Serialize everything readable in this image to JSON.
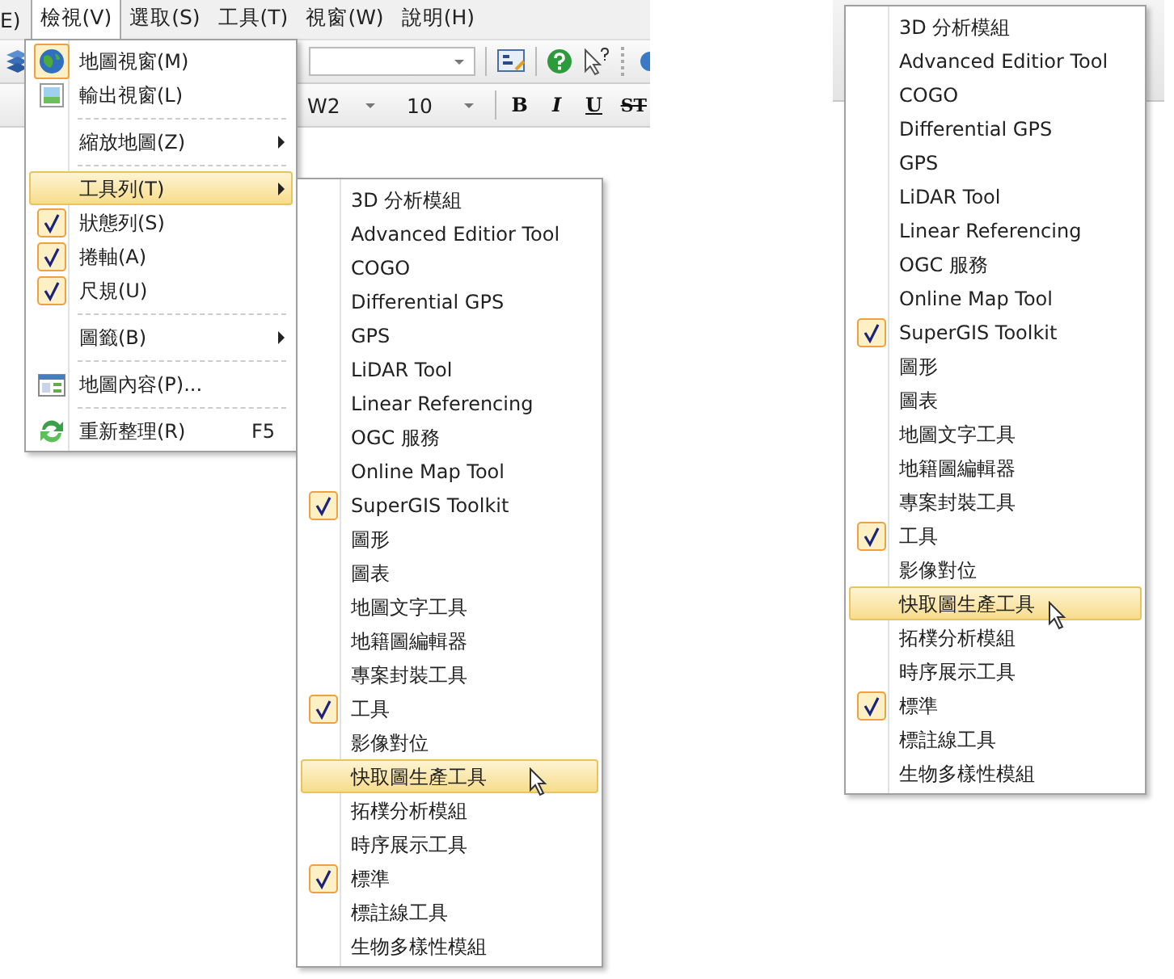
{
  "menu_bar": [
    {
      "label": "E)",
      "selected": false
    },
    {
      "label": "檢視(V)",
      "selected": true
    },
    {
      "label": "選取(S)",
      "selected": false
    },
    {
      "label": "工具(T)",
      "selected": false
    },
    {
      "label": "視窗(W)",
      "selected": false
    },
    {
      "label": "說明(H)",
      "selected": false
    }
  ],
  "toolbar": {
    "font": "W2",
    "size": "10",
    "format_buttons": [
      "B",
      "I",
      "U",
      "ST"
    ]
  },
  "view_menu": [
    {
      "kind": "icon",
      "label": "地圖視窗(M)",
      "checked": true
    },
    {
      "kind": "icon",
      "label": "輸出視窗(L)",
      "checked": false
    },
    {
      "kind": "separator"
    },
    {
      "kind": "submenu",
      "label": "縮放地圖(Z)",
      "selected": false
    },
    {
      "kind": "separator"
    },
    {
      "kind": "submenu",
      "label": "工具列(T)",
      "selected": true
    },
    {
      "kind": "check",
      "label": "狀態列(S)",
      "checked": true
    },
    {
      "kind": "check",
      "label": "捲軸(A)",
      "checked": true
    },
    {
      "kind": "check",
      "label": "尺規(U)",
      "checked": true
    },
    {
      "kind": "separator"
    },
    {
      "kind": "submenu",
      "label": "圖籤(B)",
      "selected": false
    },
    {
      "kind": "separator"
    },
    {
      "kind": "icon",
      "label": "地圖內容(P)...",
      "checked": false
    },
    {
      "kind": "separator"
    },
    {
      "kind": "icon",
      "label": "重新整理(R)",
      "checked": false,
      "shortcut": "F5"
    }
  ],
  "toolbar_submenu": [
    {
      "label": "3D 分析模組",
      "checked": false,
      "selected": false
    },
    {
      "label": "Advanced Editior Tool",
      "checked": false,
      "selected": false
    },
    {
      "label": "COGO",
      "checked": false,
      "selected": false
    },
    {
      "label": "Differential GPS",
      "checked": false,
      "selected": false
    },
    {
      "label": "GPS",
      "checked": false,
      "selected": false
    },
    {
      "label": "LiDAR Tool",
      "checked": false,
      "selected": false
    },
    {
      "label": "Linear Referencing",
      "checked": false,
      "selected": false
    },
    {
      "label": "OGC 服務",
      "checked": false,
      "selected": false
    },
    {
      "label": "Online Map Tool",
      "checked": false,
      "selected": false
    },
    {
      "label": "SuperGIS Toolkit",
      "checked": true,
      "selected": false
    },
    {
      "label": "圖形",
      "checked": false,
      "selected": false
    },
    {
      "label": "圖表",
      "checked": false,
      "selected": false
    },
    {
      "label": "地圖文字工具",
      "checked": false,
      "selected": false
    },
    {
      "label": "地籍圖編輯器",
      "checked": false,
      "selected": false
    },
    {
      "label": "專案封裝工具",
      "checked": false,
      "selected": false
    },
    {
      "label": "工具",
      "checked": true,
      "selected": false
    },
    {
      "label": "影像對位",
      "checked": false,
      "selected": false
    },
    {
      "label": "快取圖生產工具",
      "checked": false,
      "selected": true
    },
    {
      "label": "拓樸分析模組",
      "checked": false,
      "selected": false
    },
    {
      "label": "時序展示工具",
      "checked": false,
      "selected": false
    },
    {
      "label": "標準",
      "checked": true,
      "selected": false
    },
    {
      "label": "標註線工具",
      "checked": false,
      "selected": false
    },
    {
      "label": "生物多樣性模組",
      "checked": false,
      "selected": false
    }
  ],
  "zoomed_submenu": [
    {
      "label": "3D 分析模組",
      "checked": false,
      "selected": false
    },
    {
      "label": "Advanced Editior Tool",
      "checked": false,
      "selected": false
    },
    {
      "label": "COGO",
      "checked": false,
      "selected": false
    },
    {
      "label": "Differential GPS",
      "checked": false,
      "selected": false
    },
    {
      "label": "GPS",
      "checked": false,
      "selected": false
    },
    {
      "label": "LiDAR Tool",
      "checked": false,
      "selected": false
    },
    {
      "label": "Linear Referencing",
      "checked": false,
      "selected": false
    },
    {
      "label": "OGC 服務",
      "checked": false,
      "selected": false
    },
    {
      "label": "Online Map Tool",
      "checked": false,
      "selected": false
    },
    {
      "label": "SuperGIS Toolkit",
      "checked": true,
      "selected": false
    },
    {
      "label": "圖形",
      "checked": false,
      "selected": false
    },
    {
      "label": "圖表",
      "checked": false,
      "selected": false
    },
    {
      "label": "地圖文字工具",
      "checked": false,
      "selected": false
    },
    {
      "label": "地籍圖編輯器",
      "checked": false,
      "selected": false
    },
    {
      "label": "專案封裝工具",
      "checked": false,
      "selected": false
    },
    {
      "label": "工具",
      "checked": true,
      "selected": false
    },
    {
      "label": "影像對位",
      "checked": false,
      "selected": false
    },
    {
      "label": "快取圖生產工具",
      "checked": false,
      "selected": true
    },
    {
      "label": "拓樸分析模組",
      "checked": false,
      "selected": false
    },
    {
      "label": "時序展示工具",
      "checked": false,
      "selected": false
    },
    {
      "label": "標準",
      "checked": true,
      "selected": false
    },
    {
      "label": "標註線工具",
      "checked": false,
      "selected": false
    },
    {
      "label": "生物多樣性模組",
      "checked": false,
      "selected": false
    }
  ]
}
